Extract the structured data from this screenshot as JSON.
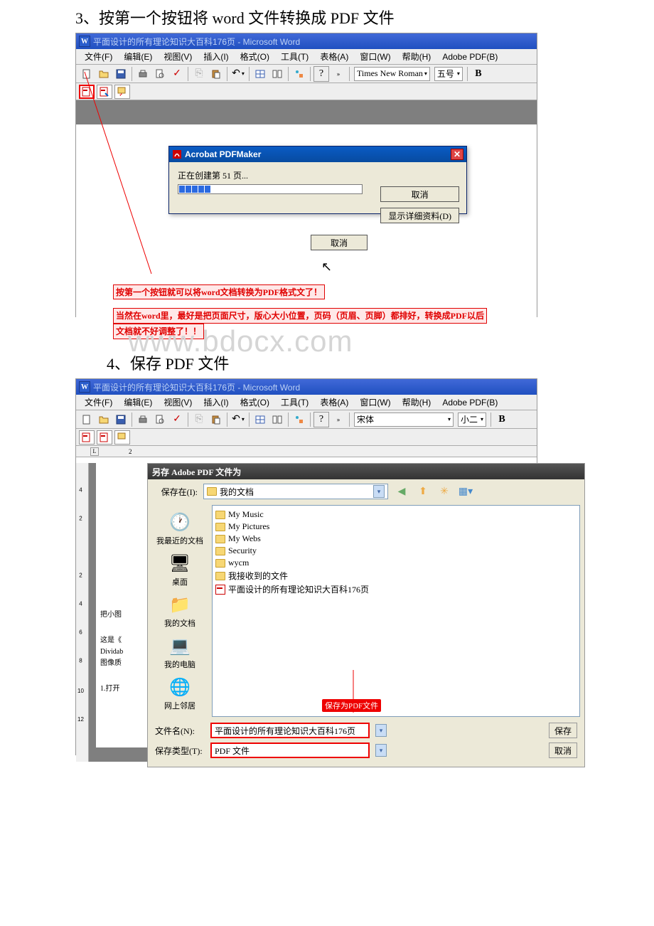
{
  "section1": {
    "title": "3、按第一个按钮将 word 文件转换成 PDF 文件",
    "window_title": "平面设计的所有理论知识大百科176页 - Microsoft Word",
    "menu": [
      "文件(F)",
      "编辑(E)",
      "视图(V)",
      "插入(I)",
      "格式(O)",
      "工具(T)",
      "表格(A)",
      "窗口(W)",
      "帮助(H)",
      "Adobe PDF(B)"
    ],
    "font_name": "Times New Roman",
    "font_size": "五号",
    "acrobat": {
      "title": "Acrobat PDFMaker",
      "status": "正在创建第 51 页...",
      "cancel": "取消",
      "details": "显示详细资料(D)"
    },
    "center_cancel": "取消",
    "annotation1": "按第一个按钮就可以将word文档转换为PDF格式文了！",
    "annotation2": "当然在word里，最好是把页面尺寸，版心大小位置，页码（页眉、页脚）都排好，转换成PDF以后",
    "annotation3": "文档就不好调整了！！"
  },
  "section2": {
    "title": "4、保存 PDF 文件",
    "window_title": "平面设计的所有理论知识大百科176页 - Microsoft Word",
    "menu": [
      "文件(F)",
      "编辑(E)",
      "视图(V)",
      "插入(I)",
      "格式(O)",
      "工具(T)",
      "表格(A)",
      "窗口(W)",
      "帮助(H)",
      "Adobe PDF(B)"
    ],
    "font_name": "宋体",
    "font_size": "小二",
    "watermark": "www.bdocx.com",
    "ruler_marks": [
      "2",
      "4",
      "2",
      "4",
      "6",
      "8",
      "10",
      "12"
    ],
    "paper_side_texts": [
      "把小图",
      "这是《",
      "Dividab",
      "图像质",
      "1.打开"
    ],
    "save_dialog": {
      "title": "另存 Adobe PDF 文件为",
      "save_in_label": "保存在(I):",
      "save_in_value": "我的文档",
      "sidebar": [
        "我最近的文档",
        "桌面",
        "我的文档",
        "我的电脑",
        "网上邻居"
      ],
      "files": [
        "My Music",
        "My Pictures",
        "My Webs",
        "Security",
        "wycm",
        "我接收到的文件",
        "平面设计的所有理论知识大百科176页"
      ],
      "filename_label": "文件名(N):",
      "filename_value": "平面设计的所有理论知识大百科176页",
      "type_label": "保存类型(T):",
      "type_value": "PDF 文件",
      "save_btn": "保存",
      "cancel_btn": "取消"
    },
    "red_callout": "保存为PDF文件"
  }
}
